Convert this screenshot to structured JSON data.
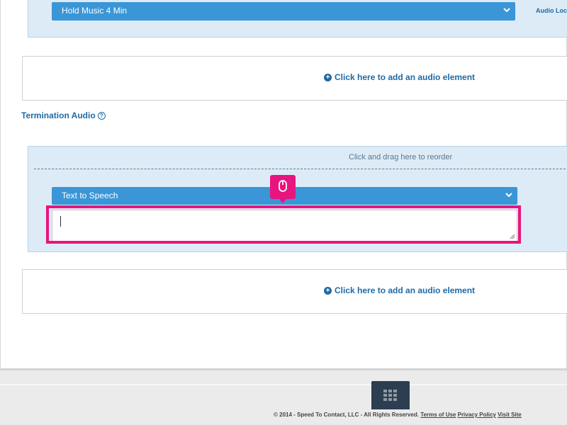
{
  "top_panel": {
    "audio_select_value": "Hold Music 4 Min",
    "audio_location_label": "Audio Loc"
  },
  "add_audio_link": "Click here to add an audio element",
  "termination": {
    "title": "Termination Audio",
    "drag_hint": "Click and drag here to reorder",
    "audio_select_value": "Text to Speech",
    "tts_text": ""
  },
  "footer": {
    "copyright": "© 2014 - Speed To Contact, LLC - All Rights Reserved.",
    "links": [
      "Terms of Use",
      "Privacy Policy",
      "Visit Site"
    ]
  },
  "colors": {
    "primary_blue": "#3a96d6",
    "link_blue": "#1f6aa5",
    "panel_bg": "#ddebf6",
    "highlight": "#e8157e",
    "footer_button": "#2c3e50"
  }
}
